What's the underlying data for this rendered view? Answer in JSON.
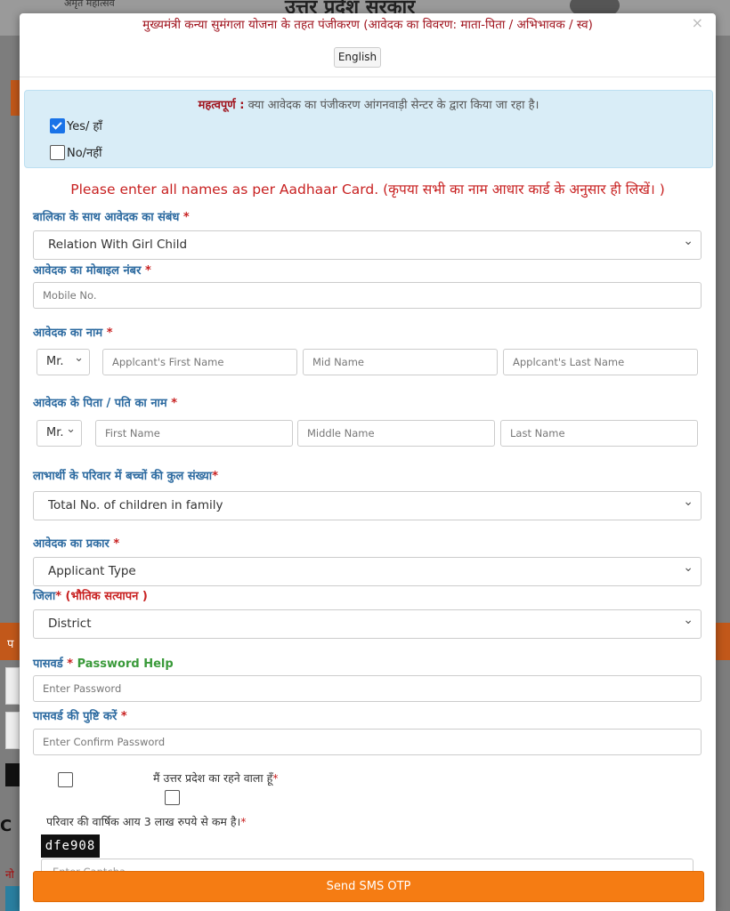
{
  "background": {
    "site_title": "उत्तर प्रदेश सरकार",
    "site_sub": "अमृत महोत्सव",
    "side_text_1": "प",
    "side_text_2": "C",
    "side_text_3": "नो",
    "side_text_4": "f",
    "side_text_5": "पु"
  },
  "modal": {
    "title": "मुख्यमंत्री कन्या सुमंगला योजना के तहत पंजीकरण (आवेदक का विवरण: माता-पिता / अभिभावक / स्व)",
    "close_glyph": "×",
    "language_button": "English"
  },
  "important": {
    "bold_prefix": "महत्वपूर्ण :",
    "question": " क्या आवेदक का पंजीकरण आंगनवाड़ी सेन्टर के द्वारा किया जा रहा है।",
    "option_yes": "Yes/ हाँ",
    "option_no": "No/नहीं",
    "yes_checked": true
  },
  "notice": "Please enter all names as per Aadhaar Card. (कृपया सभी का नाम आधार कार्ड के अनुसार ही लिखें। )",
  "fields": {
    "relation_label": "बालिका के साथ आवेदक का संबंध",
    "relation_value": "Relation With Girl Child",
    "mobile_label": "आवेदक का मोबाइल नंबर",
    "mobile_placeholder": "Mobile No.",
    "name_label": "आवेदक का नाम",
    "name_title": "Mr.",
    "first_name_placeholder": "Applcant's First Name",
    "mid_name_placeholder": "Mid Name",
    "last_name_placeholder": "Applcant's Last Name",
    "father_label": "आवेदक के पिता / पति का नाम",
    "father_title": "Mr.",
    "father_first_placeholder": "First Name",
    "father_middle_placeholder": "Middle Name",
    "father_last_placeholder": "Last Name",
    "children_label": "लाभार्थी के परिवार में बच्चों की कुल संख्या",
    "children_value": "Total No. of children in family",
    "applicant_type_label": "आवेदक का प्रकार",
    "applicant_type_value": "Applicant Type",
    "district_label": "जिला",
    "district_note": "(भौतिक सत्यापन )",
    "district_value": "District",
    "password_label": "पासवर्ड",
    "password_help": "Password Help",
    "password_placeholder": "Enter Password",
    "confirm_label": "पासवर्ड की पुष्टि करें",
    "confirm_placeholder": "Enter Confirm Password",
    "resident_text": "मैं उत्तर प्रदेश का रहने वाला हूँ",
    "income_text": "परिवार की वार्षिक आय 3 लाख रुपये से कम है।",
    "required_mark": "*",
    "captcha_code": "dfe908",
    "captcha_placeholder": "Enter Captcha",
    "submit_label": "Send SMS OTP"
  }
}
